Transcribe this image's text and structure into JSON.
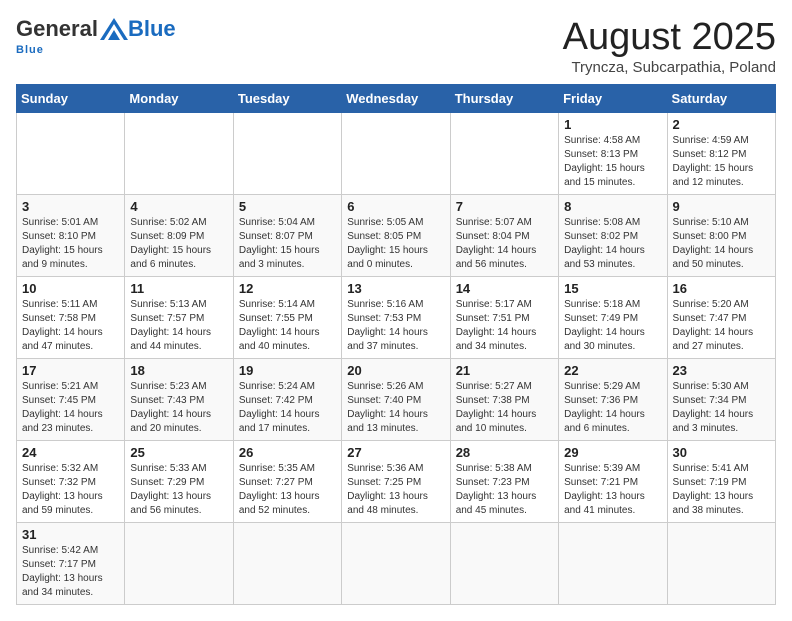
{
  "header": {
    "logo_general": "General",
    "logo_blue": "Blue",
    "logo_tagline": "Blue",
    "month_title": "August 2025",
    "location": "Tryncza, Subcarpathia, Poland"
  },
  "weekdays": [
    "Sunday",
    "Monday",
    "Tuesday",
    "Wednesday",
    "Thursday",
    "Friday",
    "Saturday"
  ],
  "weeks": [
    [
      {
        "day": "",
        "info": ""
      },
      {
        "day": "",
        "info": ""
      },
      {
        "day": "",
        "info": ""
      },
      {
        "day": "",
        "info": ""
      },
      {
        "day": "",
        "info": ""
      },
      {
        "day": "1",
        "info": "Sunrise: 4:58 AM\nSunset: 8:13 PM\nDaylight: 15 hours and 15 minutes."
      },
      {
        "day": "2",
        "info": "Sunrise: 4:59 AM\nSunset: 8:12 PM\nDaylight: 15 hours and 12 minutes."
      }
    ],
    [
      {
        "day": "3",
        "info": "Sunrise: 5:01 AM\nSunset: 8:10 PM\nDaylight: 15 hours and 9 minutes."
      },
      {
        "day": "4",
        "info": "Sunrise: 5:02 AM\nSunset: 8:09 PM\nDaylight: 15 hours and 6 minutes."
      },
      {
        "day": "5",
        "info": "Sunrise: 5:04 AM\nSunset: 8:07 PM\nDaylight: 15 hours and 3 minutes."
      },
      {
        "day": "6",
        "info": "Sunrise: 5:05 AM\nSunset: 8:05 PM\nDaylight: 15 hours and 0 minutes."
      },
      {
        "day": "7",
        "info": "Sunrise: 5:07 AM\nSunset: 8:04 PM\nDaylight: 14 hours and 56 minutes."
      },
      {
        "day": "8",
        "info": "Sunrise: 5:08 AM\nSunset: 8:02 PM\nDaylight: 14 hours and 53 minutes."
      },
      {
        "day": "9",
        "info": "Sunrise: 5:10 AM\nSunset: 8:00 PM\nDaylight: 14 hours and 50 minutes."
      }
    ],
    [
      {
        "day": "10",
        "info": "Sunrise: 5:11 AM\nSunset: 7:58 PM\nDaylight: 14 hours and 47 minutes."
      },
      {
        "day": "11",
        "info": "Sunrise: 5:13 AM\nSunset: 7:57 PM\nDaylight: 14 hours and 44 minutes."
      },
      {
        "day": "12",
        "info": "Sunrise: 5:14 AM\nSunset: 7:55 PM\nDaylight: 14 hours and 40 minutes."
      },
      {
        "day": "13",
        "info": "Sunrise: 5:16 AM\nSunset: 7:53 PM\nDaylight: 14 hours and 37 minutes."
      },
      {
        "day": "14",
        "info": "Sunrise: 5:17 AM\nSunset: 7:51 PM\nDaylight: 14 hours and 34 minutes."
      },
      {
        "day": "15",
        "info": "Sunrise: 5:18 AM\nSunset: 7:49 PM\nDaylight: 14 hours and 30 minutes."
      },
      {
        "day": "16",
        "info": "Sunrise: 5:20 AM\nSunset: 7:47 PM\nDaylight: 14 hours and 27 minutes."
      }
    ],
    [
      {
        "day": "17",
        "info": "Sunrise: 5:21 AM\nSunset: 7:45 PM\nDaylight: 14 hours and 23 minutes."
      },
      {
        "day": "18",
        "info": "Sunrise: 5:23 AM\nSunset: 7:43 PM\nDaylight: 14 hours and 20 minutes."
      },
      {
        "day": "19",
        "info": "Sunrise: 5:24 AM\nSunset: 7:42 PM\nDaylight: 14 hours and 17 minutes."
      },
      {
        "day": "20",
        "info": "Sunrise: 5:26 AM\nSunset: 7:40 PM\nDaylight: 14 hours and 13 minutes."
      },
      {
        "day": "21",
        "info": "Sunrise: 5:27 AM\nSunset: 7:38 PM\nDaylight: 14 hours and 10 minutes."
      },
      {
        "day": "22",
        "info": "Sunrise: 5:29 AM\nSunset: 7:36 PM\nDaylight: 14 hours and 6 minutes."
      },
      {
        "day": "23",
        "info": "Sunrise: 5:30 AM\nSunset: 7:34 PM\nDaylight: 14 hours and 3 minutes."
      }
    ],
    [
      {
        "day": "24",
        "info": "Sunrise: 5:32 AM\nSunset: 7:32 PM\nDaylight: 13 hours and 59 minutes."
      },
      {
        "day": "25",
        "info": "Sunrise: 5:33 AM\nSunset: 7:29 PM\nDaylight: 13 hours and 56 minutes."
      },
      {
        "day": "26",
        "info": "Sunrise: 5:35 AM\nSunset: 7:27 PM\nDaylight: 13 hours and 52 minutes."
      },
      {
        "day": "27",
        "info": "Sunrise: 5:36 AM\nSunset: 7:25 PM\nDaylight: 13 hours and 48 minutes."
      },
      {
        "day": "28",
        "info": "Sunrise: 5:38 AM\nSunset: 7:23 PM\nDaylight: 13 hours and 45 minutes."
      },
      {
        "day": "29",
        "info": "Sunrise: 5:39 AM\nSunset: 7:21 PM\nDaylight: 13 hours and 41 minutes."
      },
      {
        "day": "30",
        "info": "Sunrise: 5:41 AM\nSunset: 7:19 PM\nDaylight: 13 hours and 38 minutes."
      }
    ],
    [
      {
        "day": "31",
        "info": "Sunrise: 5:42 AM\nSunset: 7:17 PM\nDaylight: 13 hours and 34 minutes."
      },
      {
        "day": "",
        "info": ""
      },
      {
        "day": "",
        "info": ""
      },
      {
        "day": "",
        "info": ""
      },
      {
        "day": "",
        "info": ""
      },
      {
        "day": "",
        "info": ""
      },
      {
        "day": "",
        "info": ""
      }
    ]
  ]
}
